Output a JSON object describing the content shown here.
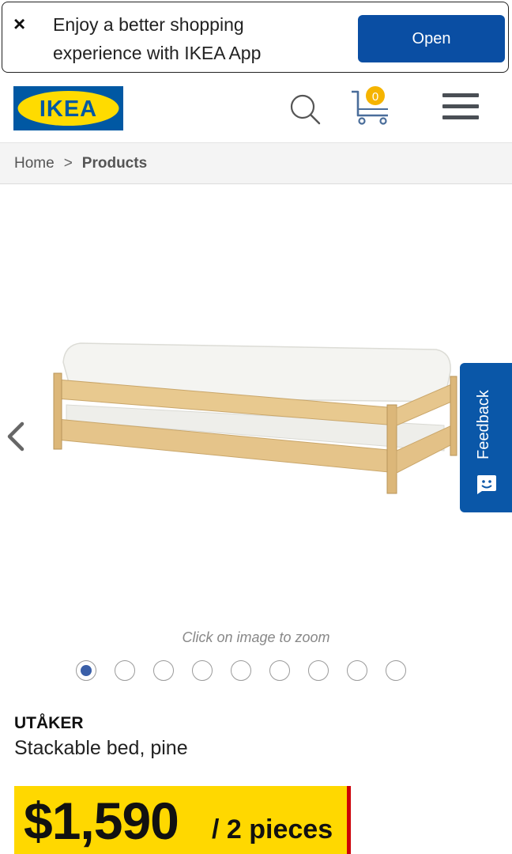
{
  "app_banner": {
    "close_symbol": "×",
    "message_line1": "Enjoy a better shopping",
    "message_line2": "experience with IKEA App",
    "open_label": "Open"
  },
  "header": {
    "logo_text": "IKEA",
    "cart_count": "0",
    "icons": [
      "search-icon",
      "cart-icon",
      "menu-icon"
    ],
    "colors": {
      "logo_blue": "#0058a3",
      "logo_yellow": "#ffdb00",
      "badge": "#f5b400"
    }
  },
  "breadcrumb": {
    "home": "Home",
    "separator": ">",
    "current": "Products"
  },
  "gallery": {
    "zoom_hint": "Click on image to zoom",
    "image_count": 9,
    "active_index": 0
  },
  "feedback": {
    "label": "Feedback"
  },
  "product": {
    "name": "UTÅKER",
    "description": "Stackable bed, pine",
    "price": "$1,590",
    "price_unit": "/ 2 pieces",
    "colors": {
      "price_bg": "#ffd800",
      "price_accent": "#cc0008"
    }
  }
}
